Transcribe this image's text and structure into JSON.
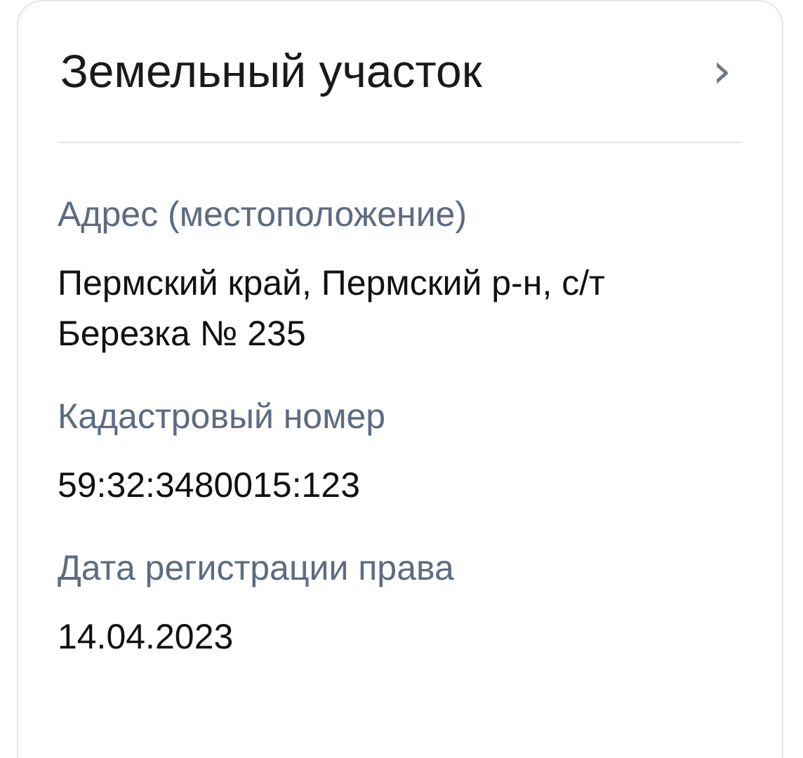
{
  "card": {
    "title": "Земельный участок",
    "chevron": "›",
    "fields": [
      {
        "label": "Адрес (местоположение)",
        "value": "Пермский край, Пермский р-н, с/т Березка № 235"
      },
      {
        "label": "Кадастровый номер",
        "value": "59:32:3480015:123"
      },
      {
        "label": "Дата регистрации права",
        "value": "14.04.2023"
      }
    ]
  }
}
